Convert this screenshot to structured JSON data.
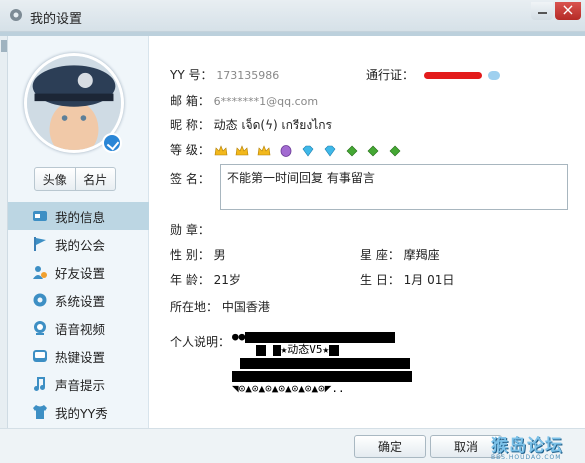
{
  "window": {
    "title": "我的设置"
  },
  "avatar_buttons": {
    "avatar": "头像",
    "card": "名片"
  },
  "sidebar": {
    "items": [
      {
        "label": "我的信息",
        "icon": "id-card-icon",
        "active": true
      },
      {
        "label": "我的公会",
        "icon": "flag-icon",
        "active": false
      },
      {
        "label": "好友设置",
        "icon": "friends-icon",
        "active": false
      },
      {
        "label": "系统设置",
        "icon": "gear-icon",
        "active": false
      },
      {
        "label": "语音视频",
        "icon": "webcam-icon",
        "active": false
      },
      {
        "label": "热键设置",
        "icon": "keyboard-icon",
        "active": false
      },
      {
        "label": "声音提示",
        "icon": "music-note-icon",
        "active": false
      },
      {
        "label": "我的YY秀",
        "icon": "shirt-icon",
        "active": false
      }
    ]
  },
  "profile": {
    "yy_label": "YY 号：",
    "yy_value": "173135986",
    "passport_label": "通行证：",
    "email_label": "邮  箱：",
    "email_value": "6*******1@qq.com",
    "nickname_label": "昵  称：",
    "nickname_value": "动态 เจ็ด(ϟ) เกรียงไกร",
    "level_label": "等  级：",
    "signature_label": "签  名：",
    "signature_value": "不能第一时间回复 有事留言",
    "medal_label": "勋  章：",
    "gender_label": "性  别：",
    "gender_value": "男",
    "zodiac_label": "星  座：",
    "zodiac_value": "摩羯座",
    "age_label": "年  龄：",
    "age_value": "21岁",
    "birthday_label": "生  日：",
    "birthday_value": "1月   01日",
    "location_label": "所在地：",
    "location_value": "中国香港",
    "bio_label": "个人说明：",
    "bio_line2_text": "★动态V5★",
    "bio_line5_text": "◥⊙▲⊙▲⊙▲⊙▲⊙▲⊙▲⊙◤.."
  },
  "level_icons": [
    "crown-icon",
    "crown-icon",
    "crown-icon",
    "gem-purple-icon",
    "diamond-icon",
    "diamond-icon",
    "leaf-icon",
    "leaf-icon",
    "leaf-icon"
  ],
  "footer": {
    "ok": "确定",
    "cancel": "取消"
  },
  "watermark": {
    "main": "猴岛论坛",
    "sub": "BBS.HOUDAO.COM"
  },
  "colors": {
    "active_nav": "#bcd6e3",
    "sidebar_bg": "#f0f6fa",
    "redaction": "#e31b1b"
  }
}
